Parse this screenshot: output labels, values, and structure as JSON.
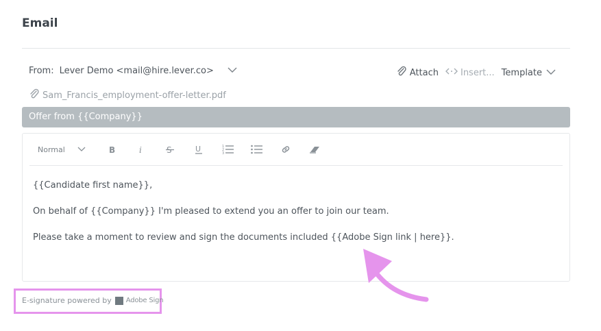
{
  "section": {
    "title": "Email"
  },
  "from": {
    "label": "From:",
    "value": "Lever Demo <mail@hire.lever.co>"
  },
  "tools": {
    "attach": "Attach",
    "insert": "Insert...",
    "template": "Template"
  },
  "attachment": {
    "filename": "Sam_Francis_employment-offer-letter.pdf"
  },
  "subject": {
    "value": "Offer from {{Company}}"
  },
  "editor": {
    "toolbar": {
      "format": "Normal",
      "buttons": [
        "bold-icon",
        "italic-icon",
        "strikethrough-icon",
        "underline-icon",
        "ordered-list-icon",
        "bullet-list-icon",
        "link-icon",
        "clear-format-icon"
      ]
    },
    "lines": [
      "{{Candidate first name}},",
      "On behalf of {{Company}} I'm pleased to extend you an offer to join our team.",
      "Please take a moment to review and sign the documents included {{Adobe Sign link | here}}."
    ]
  },
  "esignature": {
    "label": "E-signature powered by",
    "brand": "Adobe Sign"
  },
  "colors": {
    "highlight": "#e594ec",
    "subject_bar": "#b5bcc0"
  }
}
